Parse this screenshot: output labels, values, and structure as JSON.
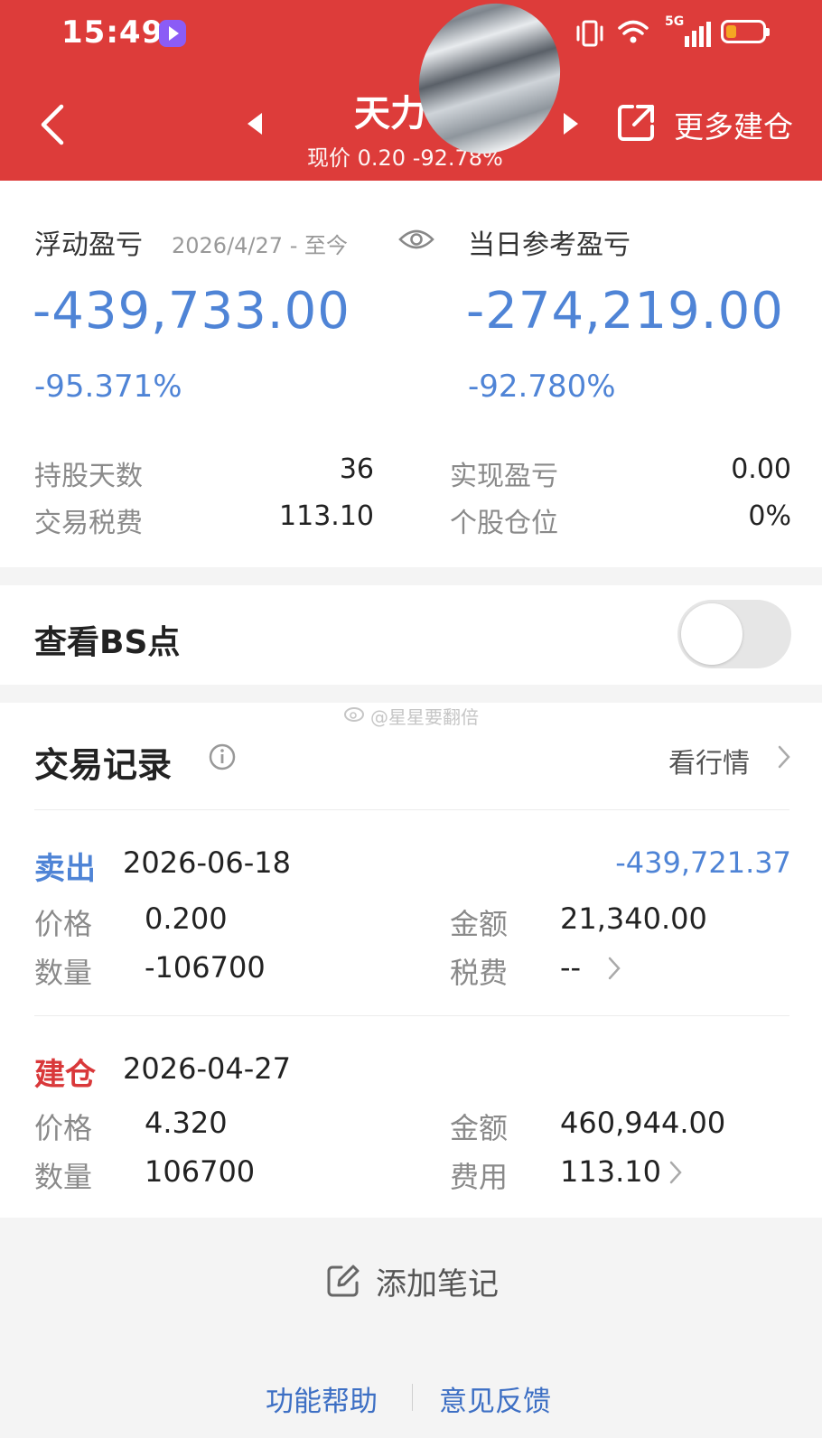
{
  "status_bar": {
    "time": "15:49",
    "network": "5G",
    "icons": [
      "app-badge-icon",
      "vibrate-icon",
      "wifi-icon",
      "signal-icon",
      "battery-low-icon"
    ]
  },
  "header": {
    "stock_name": "天力",
    "price_line": "现价 0.20 -92.78%",
    "more_button": "更多建仓",
    "colors": {
      "bar": "#dd3c3a"
    }
  },
  "summary": {
    "floating_pnl_label": "浮动盈亏",
    "date_range": "2026/4/27 - 至今",
    "daily_pnl_label": "当日参考盈亏",
    "floating_pnl_value": "-439,733.00",
    "daily_pnl_value": "-274,219.00",
    "floating_pnl_pct": "-95.371%",
    "daily_pnl_pct": "-92.780%",
    "stats": {
      "hold_days_label": "持股天数",
      "hold_days_value": "36",
      "realized_label": "实现盈亏",
      "realized_value": "0.00",
      "tax_label": "交易税费",
      "tax_value": "113.10",
      "position_label": "个股仓位",
      "position_value": "0%"
    },
    "colors": {
      "loss": "#4f84d6"
    }
  },
  "bs_points": {
    "label": "查看BS点",
    "toggle_on": false
  },
  "trades": {
    "watermark": "@星星要翻倍",
    "title": "交易记录",
    "market_link": "看行情",
    "records": [
      {
        "type": "卖出",
        "date": "2026-06-18",
        "pnl": "-439,721.37",
        "price_label": "价格",
        "price": "0.200",
        "amount_label": "金额",
        "amount": "21,340.00",
        "qty_label": "数量",
        "qty": "-106700",
        "fee_label": "税费",
        "fee": "--"
      },
      {
        "type": "建仓",
        "date": "2026-04-27",
        "price_label": "价格",
        "price": "4.320",
        "amount_label": "金额",
        "amount": "460,944.00",
        "qty_label": "数量",
        "qty": "106700",
        "fee_label": "费用",
        "fee": "113.10"
      }
    ],
    "colors": {
      "sell": "#4f84d6",
      "buy": "#d9383a"
    }
  },
  "footer": {
    "add_note": "添加笔记",
    "help": "功能帮助",
    "feedback": "意见反馈"
  }
}
